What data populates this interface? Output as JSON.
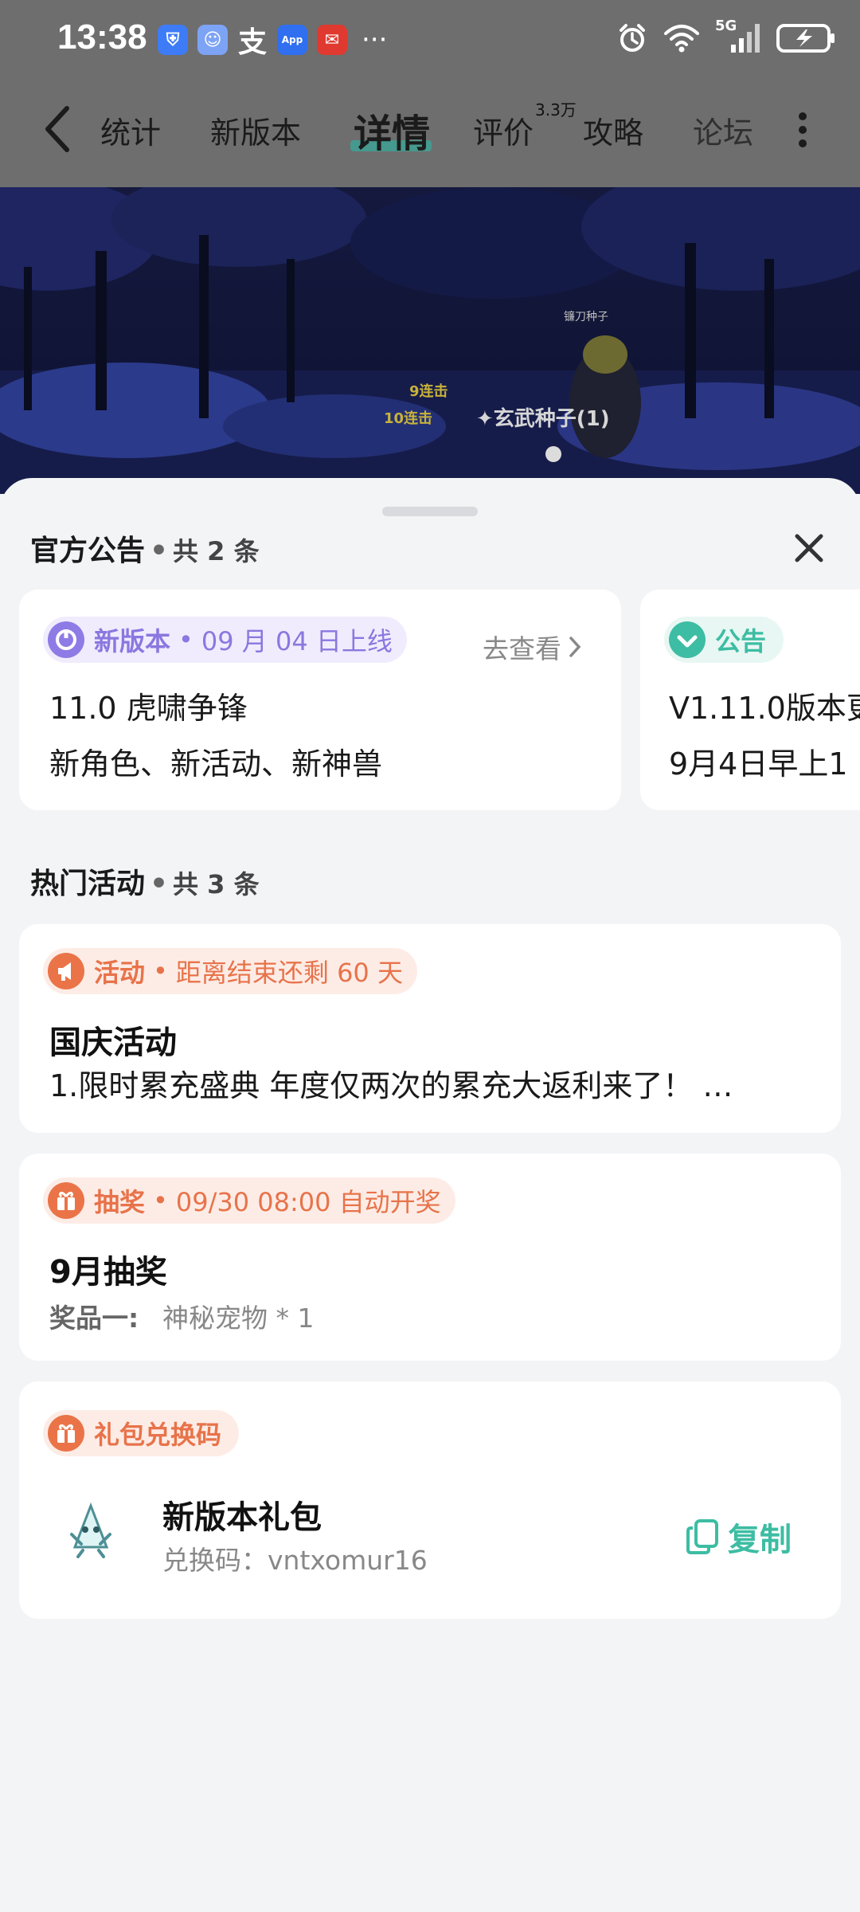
{
  "status_bar": {
    "time": "13:38",
    "apps": [
      {
        "icon": "shield-icon",
        "glyph": "⛨"
      },
      {
        "icon": "chat-bot-icon",
        "glyph": "☺"
      },
      {
        "icon": "alipay-icon",
        "glyph": "支"
      },
      {
        "icon": "app-market-icon",
        "glyph": "App"
      },
      {
        "icon": "app-red-icon",
        "glyph": "✉"
      }
    ],
    "more": "···",
    "network": "5G"
  },
  "nav": {
    "tabs": [
      {
        "label": "统计"
      },
      {
        "label": "新版本"
      },
      {
        "label": "详情",
        "active": true
      },
      {
        "label": "评价",
        "badge": "3.3万"
      },
      {
        "label": "攻略"
      },
      {
        "label": "论坛"
      }
    ]
  },
  "banner": {
    "combo1": "9连击",
    "combo2": "10连击",
    "item_popup": "✦玄武种子(1)",
    "seed_label": "镰刀种子"
  },
  "announcements": {
    "title": "官方公告",
    "count": "共 2 条",
    "cards": [
      {
        "tag": "新版本",
        "meta": "09 月 04 日上线",
        "action": "去查看",
        "line1": "11.0 虎啸争锋",
        "line2": "新角色、新活动、新神兽"
      },
      {
        "tag": "公告",
        "line1": "V1.11.0版本更",
        "line2": "9月4日早上1"
      }
    ]
  },
  "events": {
    "title": "热门活动",
    "count": "共 3 条",
    "activity": {
      "tag": "活动",
      "meta": "距离结束还剩 60 天",
      "title": "国庆活动",
      "desc": "1.限时累充盛典  年度仅两次的累充大返利来了！ …"
    },
    "lottery": {
      "tag": "抽奖",
      "meta": "09/30 08:00 自动开奖",
      "title": "9月抽奖",
      "prize_label": "奖品一:",
      "prize_value": "神秘宠物 * 1"
    },
    "gift": {
      "tag": "礼包兑换码",
      "title": "新版本礼包",
      "code": "兑换码：vntxomur16",
      "copy_label": "复制"
    }
  },
  "colors": {
    "accent_green": "#3dbda3",
    "purple": "#8f7be6",
    "orange": "#ea7448"
  }
}
